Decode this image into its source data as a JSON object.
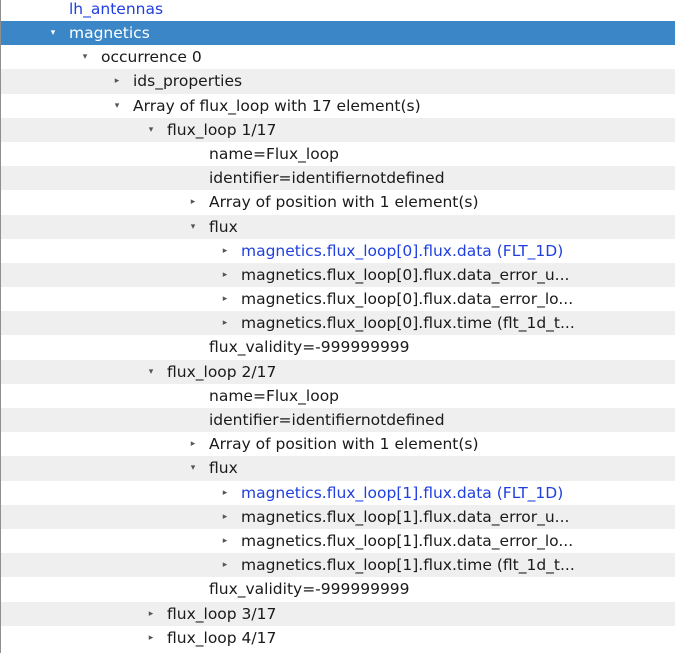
{
  "tree": {
    "rows": [
      {
        "label": "lh_antennas",
        "arrow": "",
        "level": 0,
        "link": true,
        "selected": false
      },
      {
        "label": "magnetics",
        "arrow": "▾",
        "level": 0,
        "link": false,
        "selected": true
      },
      {
        "label": "occurrence 0",
        "arrow": "▾",
        "level": 1,
        "link": false,
        "selected": false
      },
      {
        "label": "ids_properties",
        "arrow": "▸",
        "level": 2,
        "link": false,
        "selected": false
      },
      {
        "label": "Array of flux_loop with 17 element(s)",
        "arrow": "▾",
        "level": 2,
        "link": false,
        "selected": false
      },
      {
        "label": "flux_loop 1/17",
        "arrow": "▾",
        "level": 3,
        "link": false,
        "selected": false
      },
      {
        "label": "name=Flux_loop",
        "arrow": "",
        "level": 4,
        "link": false,
        "selected": false
      },
      {
        "label": "identifier=identifiernotdefined",
        "arrow": "",
        "level": 4,
        "link": false,
        "selected": false
      },
      {
        "label": "Array of position with 1 element(s)",
        "arrow": "▸",
        "level": 4,
        "link": false,
        "selected": false
      },
      {
        "label": "flux",
        "arrow": "▾",
        "level": 4,
        "link": false,
        "selected": false
      },
      {
        "label": "magnetics.flux_loop[0].flux.data (FLT_1D)",
        "arrow": "▸",
        "level": 5,
        "link": true,
        "selected": false
      },
      {
        "label": "magnetics.flux_loop[0].flux.data_error_u...",
        "arrow": "▸",
        "level": 5,
        "link": false,
        "selected": false
      },
      {
        "label": "magnetics.flux_loop[0].flux.data_error_lo...",
        "arrow": "▸",
        "level": 5,
        "link": false,
        "selected": false
      },
      {
        "label": "magnetics.flux_loop[0].flux.time (flt_1d_t...",
        "arrow": "▸",
        "level": 5,
        "link": false,
        "selected": false
      },
      {
        "label": "flux_validity=-999999999",
        "arrow": "",
        "level": 4,
        "link": false,
        "selected": false
      },
      {
        "label": "flux_loop 2/17",
        "arrow": "▾",
        "level": 3,
        "link": false,
        "selected": false
      },
      {
        "label": "name=Flux_loop",
        "arrow": "",
        "level": 4,
        "link": false,
        "selected": false
      },
      {
        "label": "identifier=identifiernotdefined",
        "arrow": "",
        "level": 4,
        "link": false,
        "selected": false
      },
      {
        "label": "Array of position with 1 element(s)",
        "arrow": "▸",
        "level": 4,
        "link": false,
        "selected": false
      },
      {
        "label": "flux",
        "arrow": "▾",
        "level": 4,
        "link": false,
        "selected": false
      },
      {
        "label": "magnetics.flux_loop[1].flux.data (FLT_1D)",
        "arrow": "▸",
        "level": 5,
        "link": true,
        "selected": false
      },
      {
        "label": "magnetics.flux_loop[1].flux.data_error_u...",
        "arrow": "▸",
        "level": 5,
        "link": false,
        "selected": false
      },
      {
        "label": "magnetics.flux_loop[1].flux.data_error_lo...",
        "arrow": "▸",
        "level": 5,
        "link": false,
        "selected": false
      },
      {
        "label": "magnetics.flux_loop[1].flux.time (flt_1d_t...",
        "arrow": "▸",
        "level": 5,
        "link": false,
        "selected": false
      },
      {
        "label": "flux_validity=-999999999",
        "arrow": "",
        "level": 4,
        "link": false,
        "selected": false
      },
      {
        "label": "flux_loop 3/17",
        "arrow": "▸",
        "level": 3,
        "link": false,
        "selected": false
      },
      {
        "label": "flux_loop 4/17",
        "arrow": "▸",
        "level": 3,
        "link": false,
        "selected": false
      }
    ]
  },
  "colors": {
    "selection": "#3a86c7",
    "link": "#1f3fe0",
    "alt_row": "#efefef"
  }
}
